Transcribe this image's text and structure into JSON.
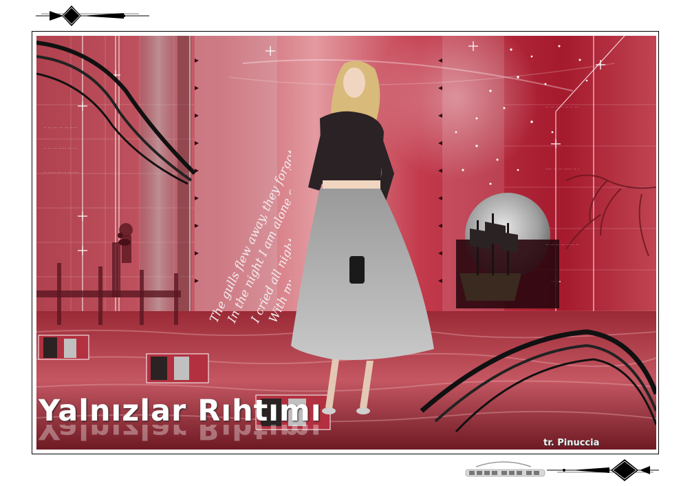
{
  "title": "Yalnızlar Rıhtımı",
  "credit": "tr. Pinuccia",
  "poem": [
    "The gulls flew away, they forgot me",
    "In the night I am alone on the dock by the sea",
    "I cried all night as the waves lapped on",
    "With my tear-filled eyes on the dock alone"
  ],
  "colors": {
    "frame_border": "#000000",
    "accent_red": "#a91f31",
    "light_pink": "#d9707a",
    "title_white": "#ffffff"
  },
  "icons": [
    "diamond-ornament-icon",
    "star-icon",
    "moon-icon",
    "ship-icon",
    "seagull-icon"
  ]
}
